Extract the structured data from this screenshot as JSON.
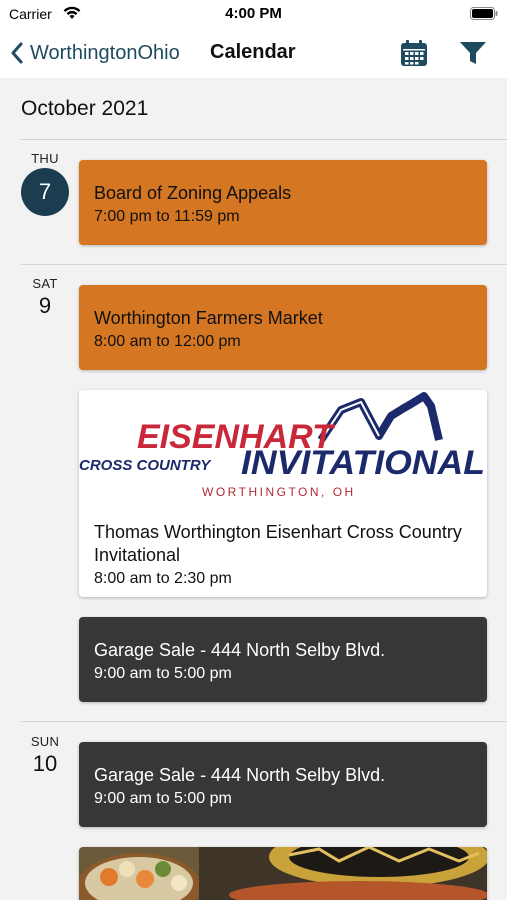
{
  "status_bar": {
    "carrier": "Carrier",
    "time": "4:00 PM"
  },
  "nav": {
    "back_label": "WorthingtonOhio",
    "title": "Calendar"
  },
  "month": "October 2021",
  "days": [
    {
      "dow": "THU",
      "day": "7"
    },
    {
      "dow": "SAT",
      "day": "9"
    },
    {
      "dow": "SUN",
      "day": "10"
    }
  ],
  "events": [
    {
      "title": "Board of Zoning Appeals",
      "time": "7:00 pm to 11:59 pm"
    },
    {
      "title": "Worthington Farmers Market",
      "time": "8:00 am to 12:00 pm"
    },
    {
      "title": "Thomas Worthington Eisenhart Cross Country Invitational",
      "time": "8:00 am to 2:30 pm"
    },
    {
      "title": "Garage Sale - 444 North Selby Blvd.",
      "time": "9:00 am to 5:00 pm"
    },
    {
      "title": "Garage Sale - 444 North Selby Blvd.",
      "time": "9:00 am to 5:00 pm"
    }
  ],
  "logo": {
    "line1": "EISENHART",
    "line2a": "CROSS COUNTRY",
    "line2b": "INVITATIONAL",
    "line3": "WORTHINGTON, OH"
  },
  "colors": {
    "orange_event": "#d47622",
    "dark_event": "#373737",
    "today_circle": "#1c3d50",
    "nav_tint": "#1f4b60"
  },
  "icons": {
    "back": "chevron-left-icon",
    "calendar": "calendar-icon",
    "filter": "filter-icon"
  }
}
